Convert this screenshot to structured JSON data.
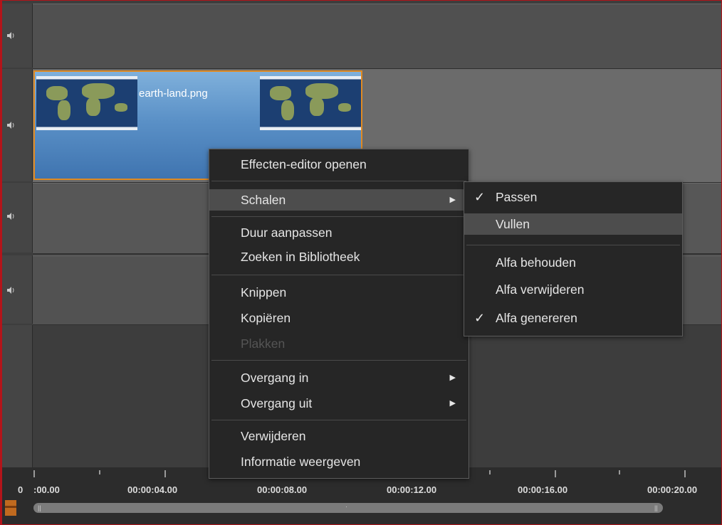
{
  "clip": {
    "title": "earth-land.png"
  },
  "timeline": {
    "labels": [
      {
        "text": "0"
      },
      {
        "text": ":00.00"
      },
      {
        "text": "00:00:04.00"
      },
      {
        "text": "00:00:08.00"
      },
      {
        "text": "00:00:12.00"
      },
      {
        "text": "00:00:16.00"
      },
      {
        "text": "00:00:20.00"
      }
    ]
  },
  "context_menu": {
    "items": [
      {
        "label": "Effecten-editor openen"
      },
      {
        "label": "Schalen",
        "submenu": true,
        "highlighted": true
      },
      {
        "label": "Duur aanpassen"
      },
      {
        "label": "Zoeken in Bibliotheek"
      },
      {
        "label": "Knippen"
      },
      {
        "label": "Kopiëren"
      },
      {
        "label": "Plakken",
        "disabled": true
      },
      {
        "label": "Overgang in",
        "submenu": true
      },
      {
        "label": "Overgang uit",
        "submenu": true
      },
      {
        "label": "Verwijderen"
      },
      {
        "label": "Informatie weergeven"
      }
    ]
  },
  "submenu": {
    "items": [
      {
        "label": "Passen",
        "checked": true
      },
      {
        "label": "Vullen",
        "highlighted": true
      },
      {
        "label": "Alfa behouden"
      },
      {
        "label": "Alfa verwijderen"
      },
      {
        "label": "Alfa genereren",
        "checked": true
      }
    ]
  },
  "colors": {
    "frame_border": "#b3141a",
    "clip_border": "#e08a22",
    "clip_fill": "#5b91c7",
    "menu_bg": "#262626",
    "menu_highlight": "#4d4d4d"
  },
  "icons": {
    "track_audio": "speaker-icon",
    "submenu": "submenu-arrow-icon",
    "check": "checkmark-icon"
  }
}
